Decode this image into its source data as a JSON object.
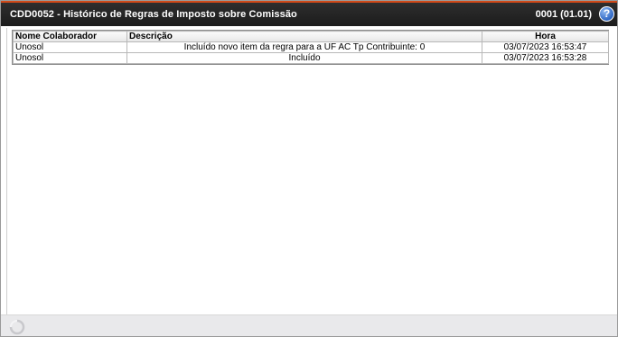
{
  "window": {
    "title": "CDD0052 - Histórico de Regras de Imposto sobre Comissão",
    "version": "0001 (01.01)",
    "help_label": "?"
  },
  "grid": {
    "columns": [
      "Nome Colaborador",
      "Descrição",
      "Hora"
    ],
    "rows": [
      {
        "colaborador": "Unosol",
        "descricao": "Incluído novo item da regra para a UF AC Tp Contribuinte: 0",
        "hora": "03/07/2023 16:53:47"
      },
      {
        "colaborador": "Unosol",
        "descricao": "Incluído",
        "hora": "03/07/2023 16:53:28"
      }
    ]
  },
  "icons": {
    "help": "help-icon",
    "status": "loading-spinner-icon"
  },
  "colors": {
    "titlebar": "#1c1c1c",
    "title_accent": "#d04a1a",
    "help_icon": "#2f67c4",
    "statusbar": "#e9e9eb"
  }
}
